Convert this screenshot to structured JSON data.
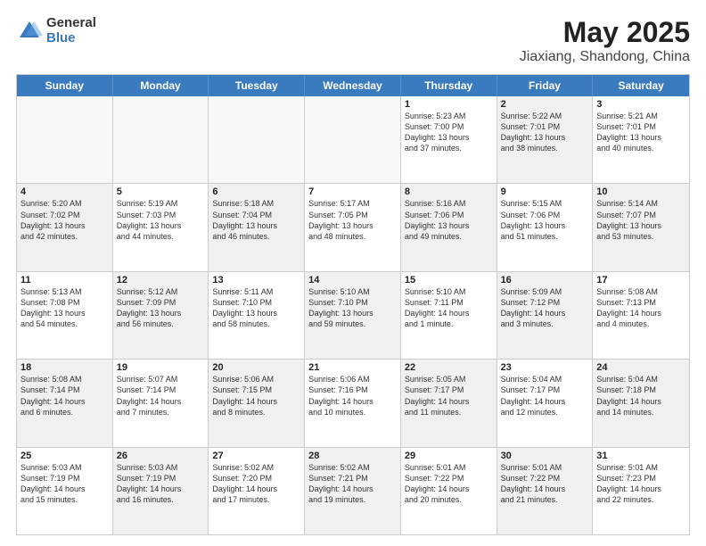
{
  "logo": {
    "general": "General",
    "blue": "Blue"
  },
  "title": "May 2025",
  "subtitle": "Jiaxiang, Shandong, China",
  "weekdays": [
    "Sunday",
    "Monday",
    "Tuesday",
    "Wednesday",
    "Thursday",
    "Friday",
    "Saturday"
  ],
  "rows": [
    [
      {
        "day": "",
        "lines": [],
        "shade": "empty"
      },
      {
        "day": "",
        "lines": [],
        "shade": "empty"
      },
      {
        "day": "",
        "lines": [],
        "shade": "empty"
      },
      {
        "day": "",
        "lines": [],
        "shade": "empty"
      },
      {
        "day": "1",
        "lines": [
          "Sunrise: 5:23 AM",
          "Sunset: 7:00 PM",
          "Daylight: 13 hours",
          "and 37 minutes."
        ],
        "shade": ""
      },
      {
        "day": "2",
        "lines": [
          "Sunrise: 5:22 AM",
          "Sunset: 7:01 PM",
          "Daylight: 13 hours",
          "and 38 minutes."
        ],
        "shade": "shaded"
      },
      {
        "day": "3",
        "lines": [
          "Sunrise: 5:21 AM",
          "Sunset: 7:01 PM",
          "Daylight: 13 hours",
          "and 40 minutes."
        ],
        "shade": ""
      }
    ],
    [
      {
        "day": "4",
        "lines": [
          "Sunrise: 5:20 AM",
          "Sunset: 7:02 PM",
          "Daylight: 13 hours",
          "and 42 minutes."
        ],
        "shade": "shaded"
      },
      {
        "day": "5",
        "lines": [
          "Sunrise: 5:19 AM",
          "Sunset: 7:03 PM",
          "Daylight: 13 hours",
          "and 44 minutes."
        ],
        "shade": ""
      },
      {
        "day": "6",
        "lines": [
          "Sunrise: 5:18 AM",
          "Sunset: 7:04 PM",
          "Daylight: 13 hours",
          "and 46 minutes."
        ],
        "shade": "shaded"
      },
      {
        "day": "7",
        "lines": [
          "Sunrise: 5:17 AM",
          "Sunset: 7:05 PM",
          "Daylight: 13 hours",
          "and 48 minutes."
        ],
        "shade": ""
      },
      {
        "day": "8",
        "lines": [
          "Sunrise: 5:16 AM",
          "Sunset: 7:06 PM",
          "Daylight: 13 hours",
          "and 49 minutes."
        ],
        "shade": "shaded"
      },
      {
        "day": "9",
        "lines": [
          "Sunrise: 5:15 AM",
          "Sunset: 7:06 PM",
          "Daylight: 13 hours",
          "and 51 minutes."
        ],
        "shade": ""
      },
      {
        "day": "10",
        "lines": [
          "Sunrise: 5:14 AM",
          "Sunset: 7:07 PM",
          "Daylight: 13 hours",
          "and 53 minutes."
        ],
        "shade": "shaded"
      }
    ],
    [
      {
        "day": "11",
        "lines": [
          "Sunrise: 5:13 AM",
          "Sunset: 7:08 PM",
          "Daylight: 13 hours",
          "and 54 minutes."
        ],
        "shade": ""
      },
      {
        "day": "12",
        "lines": [
          "Sunrise: 5:12 AM",
          "Sunset: 7:09 PM",
          "Daylight: 13 hours",
          "and 56 minutes."
        ],
        "shade": "shaded"
      },
      {
        "day": "13",
        "lines": [
          "Sunrise: 5:11 AM",
          "Sunset: 7:10 PM",
          "Daylight: 13 hours",
          "and 58 minutes."
        ],
        "shade": ""
      },
      {
        "day": "14",
        "lines": [
          "Sunrise: 5:10 AM",
          "Sunset: 7:10 PM",
          "Daylight: 13 hours",
          "and 59 minutes."
        ],
        "shade": "shaded"
      },
      {
        "day": "15",
        "lines": [
          "Sunrise: 5:10 AM",
          "Sunset: 7:11 PM",
          "Daylight: 14 hours",
          "and 1 minute."
        ],
        "shade": ""
      },
      {
        "day": "16",
        "lines": [
          "Sunrise: 5:09 AM",
          "Sunset: 7:12 PM",
          "Daylight: 14 hours",
          "and 3 minutes."
        ],
        "shade": "shaded"
      },
      {
        "day": "17",
        "lines": [
          "Sunrise: 5:08 AM",
          "Sunset: 7:13 PM",
          "Daylight: 14 hours",
          "and 4 minutes."
        ],
        "shade": ""
      }
    ],
    [
      {
        "day": "18",
        "lines": [
          "Sunrise: 5:08 AM",
          "Sunset: 7:14 PM",
          "Daylight: 14 hours",
          "and 6 minutes."
        ],
        "shade": "shaded"
      },
      {
        "day": "19",
        "lines": [
          "Sunrise: 5:07 AM",
          "Sunset: 7:14 PM",
          "Daylight: 14 hours",
          "and 7 minutes."
        ],
        "shade": ""
      },
      {
        "day": "20",
        "lines": [
          "Sunrise: 5:06 AM",
          "Sunset: 7:15 PM",
          "Daylight: 14 hours",
          "and 8 minutes."
        ],
        "shade": "shaded"
      },
      {
        "day": "21",
        "lines": [
          "Sunrise: 5:06 AM",
          "Sunset: 7:16 PM",
          "Daylight: 14 hours",
          "and 10 minutes."
        ],
        "shade": ""
      },
      {
        "day": "22",
        "lines": [
          "Sunrise: 5:05 AM",
          "Sunset: 7:17 PM",
          "Daylight: 14 hours",
          "and 11 minutes."
        ],
        "shade": "shaded"
      },
      {
        "day": "23",
        "lines": [
          "Sunrise: 5:04 AM",
          "Sunset: 7:17 PM",
          "Daylight: 14 hours",
          "and 12 minutes."
        ],
        "shade": ""
      },
      {
        "day": "24",
        "lines": [
          "Sunrise: 5:04 AM",
          "Sunset: 7:18 PM",
          "Daylight: 14 hours",
          "and 14 minutes."
        ],
        "shade": "shaded"
      }
    ],
    [
      {
        "day": "25",
        "lines": [
          "Sunrise: 5:03 AM",
          "Sunset: 7:19 PM",
          "Daylight: 14 hours",
          "and 15 minutes."
        ],
        "shade": ""
      },
      {
        "day": "26",
        "lines": [
          "Sunrise: 5:03 AM",
          "Sunset: 7:19 PM",
          "Daylight: 14 hours",
          "and 16 minutes."
        ],
        "shade": "shaded"
      },
      {
        "day": "27",
        "lines": [
          "Sunrise: 5:02 AM",
          "Sunset: 7:20 PM",
          "Daylight: 14 hours",
          "and 17 minutes."
        ],
        "shade": ""
      },
      {
        "day": "28",
        "lines": [
          "Sunrise: 5:02 AM",
          "Sunset: 7:21 PM",
          "Daylight: 14 hours",
          "and 19 minutes."
        ],
        "shade": "shaded"
      },
      {
        "day": "29",
        "lines": [
          "Sunrise: 5:01 AM",
          "Sunset: 7:22 PM",
          "Daylight: 14 hours",
          "and 20 minutes."
        ],
        "shade": ""
      },
      {
        "day": "30",
        "lines": [
          "Sunrise: 5:01 AM",
          "Sunset: 7:22 PM",
          "Daylight: 14 hours",
          "and 21 minutes."
        ],
        "shade": "shaded"
      },
      {
        "day": "31",
        "lines": [
          "Sunrise: 5:01 AM",
          "Sunset: 7:23 PM",
          "Daylight: 14 hours",
          "and 22 minutes."
        ],
        "shade": ""
      }
    ]
  ]
}
